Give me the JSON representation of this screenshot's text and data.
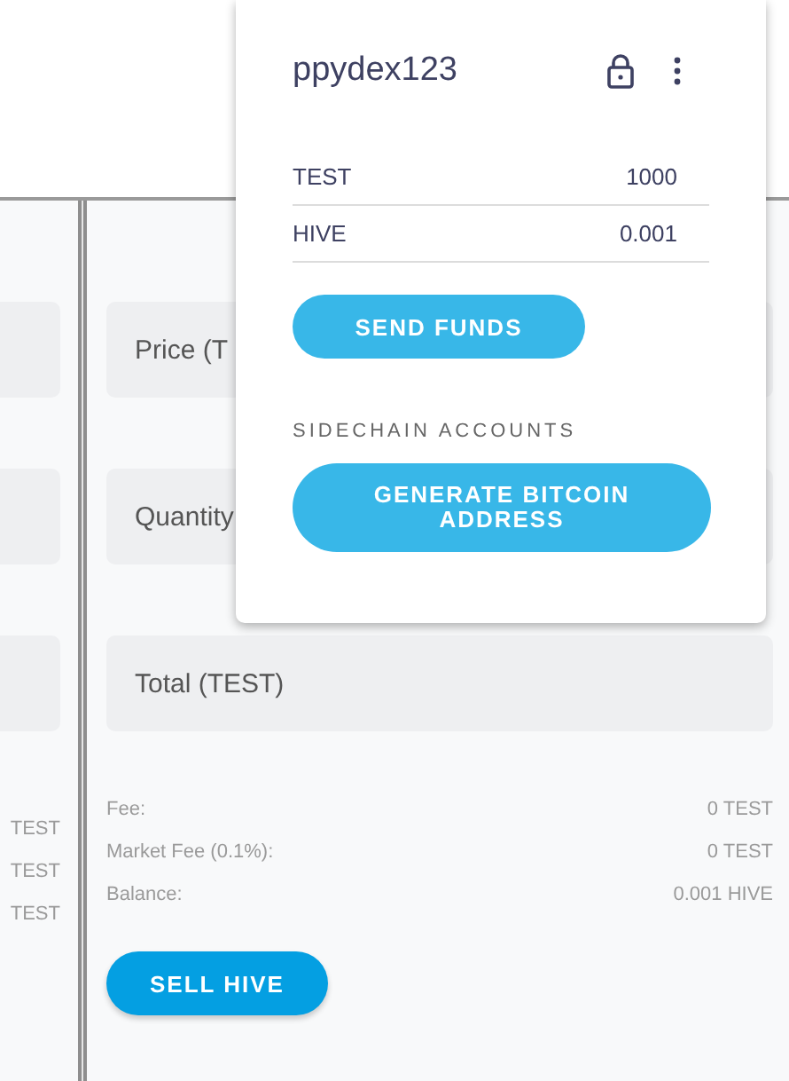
{
  "left_panel": {
    "info_values": [
      "TEST",
      "TEST",
      "TEST"
    ]
  },
  "order_form": {
    "fields": [
      {
        "label": "Price (T"
      },
      {
        "label": "Quantity"
      },
      {
        "label": "Total (TEST)"
      }
    ],
    "info": [
      {
        "label": "Fee:",
        "value": "0 TEST"
      },
      {
        "label": "Market Fee (0.1%):",
        "value": "0 TEST"
      },
      {
        "label": "Balance:",
        "value": "0.001 HIVE"
      }
    ],
    "button": "SELL HIVE"
  },
  "account_popup": {
    "username": "ppydex123",
    "balances": [
      {
        "token": "TEST",
        "amount": "1000"
      },
      {
        "token": "HIVE",
        "amount": "0.001"
      }
    ],
    "send_button": "SEND FUNDS",
    "section_title": "SIDECHAIN ACCOUNTS",
    "generate_button": "GENERATE BITCOIN ADDRESS"
  }
}
